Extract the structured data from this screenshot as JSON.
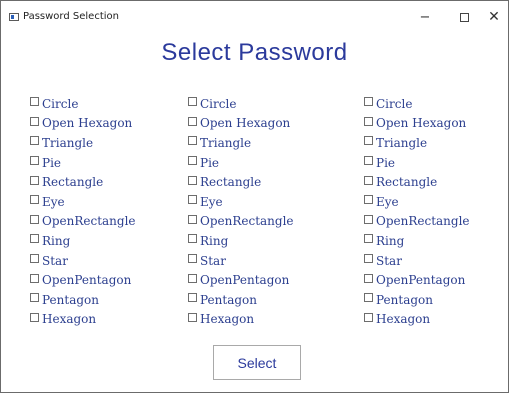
{
  "window": {
    "title": "Password Selection",
    "minimize_glyph": "−",
    "close_glyph": "✕"
  },
  "heading": "Select Password",
  "columns": [
    [
      "Circle",
      "Open Hexagon",
      "Triangle",
      "Pie",
      "Rectangle",
      "Eye",
      "OpenRectangle",
      "Ring",
      "Star",
      "OpenPentagon",
      "Pentagon",
      "Hexagon"
    ],
    [
      "Circle",
      "Open Hexagon",
      "Triangle",
      "Pie",
      "Rectangle",
      "Eye",
      "OpenRectangle",
      "Ring",
      "Star",
      "OpenPentagon",
      "Pentagon",
      "Hexagon"
    ],
    [
      "Circle",
      "Open Hexagon",
      "Triangle",
      "Pie",
      "Rectangle",
      "Eye",
      "OpenRectangle",
      "Ring",
      "Star",
      "OpenPentagon",
      "Pentagon",
      "Hexagon"
    ]
  ],
  "select_button": "Select",
  "colors": {
    "accent": "#2b3a9c",
    "label": "#2c3f8f"
  }
}
